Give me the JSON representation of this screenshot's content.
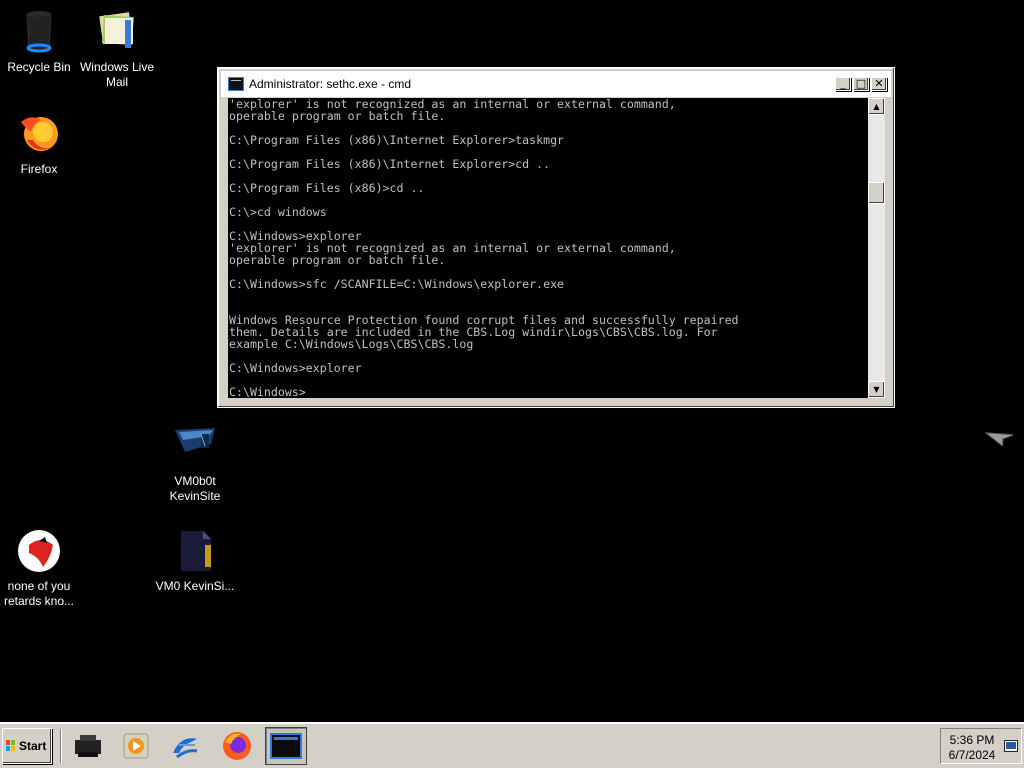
{
  "desktop": {
    "icons": [
      {
        "label": "Recycle Bin",
        "icon": "recycle-bin-icon"
      },
      {
        "label": "Windows Live Mail",
        "icon": "mail-icon"
      },
      {
        "label": "Firefox",
        "icon": "firefox-icon"
      },
      {
        "label": "VM0b0t KevinSite",
        "icon": "shortcut-icon"
      },
      {
        "label": "none of you retards kno...",
        "icon": "bird-icon"
      },
      {
        "label": "VM0 KevinSi...",
        "icon": "file-icon"
      }
    ]
  },
  "window": {
    "title": "Administrator: sethc.exe - cmd",
    "buttons": {
      "minimize": "_",
      "maximize": "□",
      "close": "✕"
    },
    "console_lines": [
      "'explorer' is not recognized as an internal or external command,",
      "operable program or batch file.",
      "",
      "C:\\Program Files (x86)\\Internet Explorer>taskmgr",
      "",
      "C:\\Program Files (x86)\\Internet Explorer>cd ..",
      "",
      "C:\\Program Files (x86)>cd ..",
      "",
      "C:\\>cd windows",
      "",
      "C:\\Windows>explorer",
      "'explorer' is not recognized as an internal or external command,",
      "operable program or batch file.",
      "",
      "C:\\Windows>sfc /SCANFILE=C:\\Windows\\explorer.exe",
      "",
      "",
      "Windows Resource Protection found corrupt files and successfully repaired",
      "them. Details are included in the CBS.Log windir\\Logs\\CBS\\CBS.log. For",
      "example C:\\Windows\\Logs\\CBS\\CBS.log",
      "",
      "C:\\Windows>explorer",
      "",
      "C:\\Windows>"
    ],
    "scroll_up": "▲",
    "scroll_down": "▼"
  },
  "taskbar": {
    "start_label": "Start",
    "apps": [
      "printer-icon",
      "media-player-icon",
      "edge-legacy-icon",
      "firefox-icon",
      "cmd-icon"
    ],
    "clock_time": "5:36 PM",
    "clock_date": "6/7/2024"
  },
  "colors": {
    "desktop": "#000000",
    "console_text": "#c0c0c0",
    "taskbar": "#d4d0c8"
  }
}
